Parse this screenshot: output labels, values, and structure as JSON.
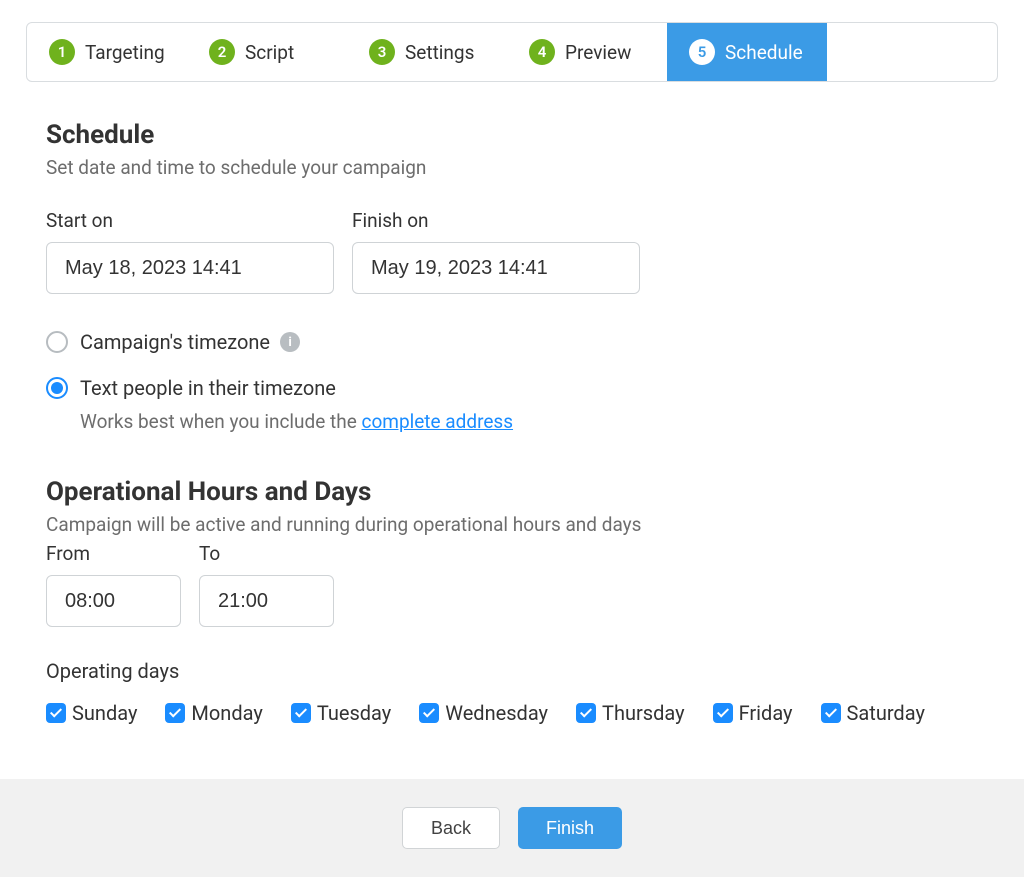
{
  "tabs": [
    {
      "step": "1",
      "label": "Targeting",
      "active": false
    },
    {
      "step": "2",
      "label": "Script",
      "active": false
    },
    {
      "step": "3",
      "label": "Settings",
      "active": false
    },
    {
      "step": "4",
      "label": "Preview",
      "active": false
    },
    {
      "step": "5",
      "label": "Schedule",
      "active": true
    }
  ],
  "schedule": {
    "title": "Schedule",
    "desc": "Set date and time to schedule your campaign",
    "start_label": "Start on",
    "start_value": "May 18, 2023 14:41",
    "finish_label": "Finish on",
    "finish_value": "May 19, 2023 14:41"
  },
  "timezone": {
    "opt_campaign": "Campaign's timezone",
    "opt_people": "Text people in their timezone",
    "help_text": "Works best when you include the  ",
    "help_link": "complete address",
    "selected": "people"
  },
  "ops": {
    "title": "Operational Hours and Days",
    "desc": "Campaign will be active and running during operational hours and days",
    "from_label": "From",
    "from_value": "08:00",
    "to_label": "To",
    "to_value": "21:00",
    "days_label": "Operating days",
    "days": [
      {
        "label": "Sunday",
        "checked": true
      },
      {
        "label": "Monday",
        "checked": true
      },
      {
        "label": "Tuesday",
        "checked": true
      },
      {
        "label": "Wednesday",
        "checked": true
      },
      {
        "label": "Thursday",
        "checked": true
      },
      {
        "label": "Friday",
        "checked": true
      },
      {
        "label": "Saturday",
        "checked": true
      }
    ]
  },
  "footer": {
    "back": "Back",
    "finish": "Finish"
  }
}
